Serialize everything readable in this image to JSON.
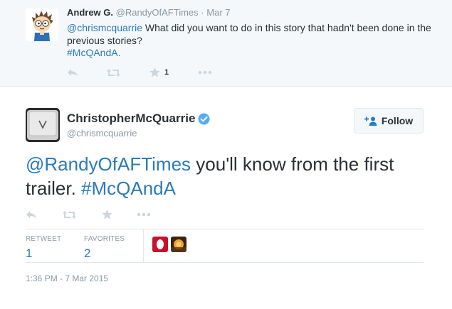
{
  "parent_tweet": {
    "name": "Andrew G.",
    "handle": "@RandyOfAFTimes",
    "separator": "·",
    "date": "Mar 7",
    "mention": "@chrismcquarrie",
    "text": " What did you want to do in this story that hadn't been done in the previous stories?",
    "hashtag": "#McQAndA.",
    "favorite_count": "1",
    "icons": [
      "reply-icon",
      "retweet-icon",
      "favorite-icon",
      "more-icon"
    ]
  },
  "main_tweet": {
    "name": "ChristopherMcQuarrie",
    "handle": "@chrismcquarrie",
    "follow_label": "Follow",
    "mention": "@RandyOfAFTimes",
    "text": " you'll know from the first trailer. ",
    "hashtag": "#McQAndA",
    "stats": {
      "retweet_label": "RETWEET",
      "retweet_count": "1",
      "favorites_label": "FAVORITES",
      "favorites_count": "2"
    },
    "timestamp": "1:36 PM - 7 Mar 2015",
    "icons": [
      "reply-icon",
      "retweet-icon",
      "favorite-icon",
      "more-icon"
    ]
  },
  "colors": {
    "link": "#2b7bb9",
    "muted": "#8899a6",
    "verified": "#55acee",
    "parent_bg": "#f5f8fa"
  }
}
